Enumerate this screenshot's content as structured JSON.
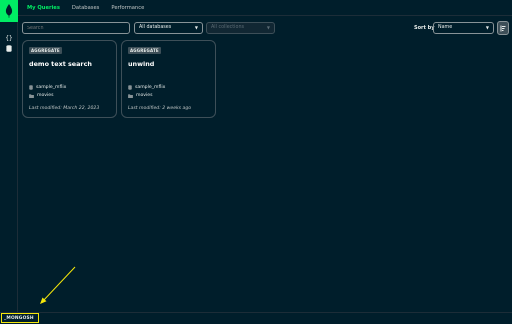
{
  "tabs": [
    {
      "label": "My Queries",
      "active": true
    },
    {
      "label": "Databases",
      "active": false
    },
    {
      "label": "Performance",
      "active": false
    }
  ],
  "toolbar": {
    "search_placeholder": "Search",
    "database_select": "All databases",
    "collection_select": "All collections",
    "sort_label": "Sort by",
    "sort_value": "Name"
  },
  "cards": [
    {
      "type": "AGGREGATE",
      "title": "demo text search",
      "database": "sample_mflix",
      "collection": "movies",
      "last_modified": "Last modified: March 22, 2023"
    },
    {
      "type": "AGGREGATE",
      "title": "unwind",
      "database": "sample_mflix",
      "collection": "movies",
      "last_modified": "Last modified: 2 weeks ago"
    }
  ],
  "bottom": {
    "shell_label": "_MONGOSH"
  },
  "colors": {
    "accent": "#00ed64",
    "background": "#001e2b",
    "annotation": "#f5e70a"
  }
}
